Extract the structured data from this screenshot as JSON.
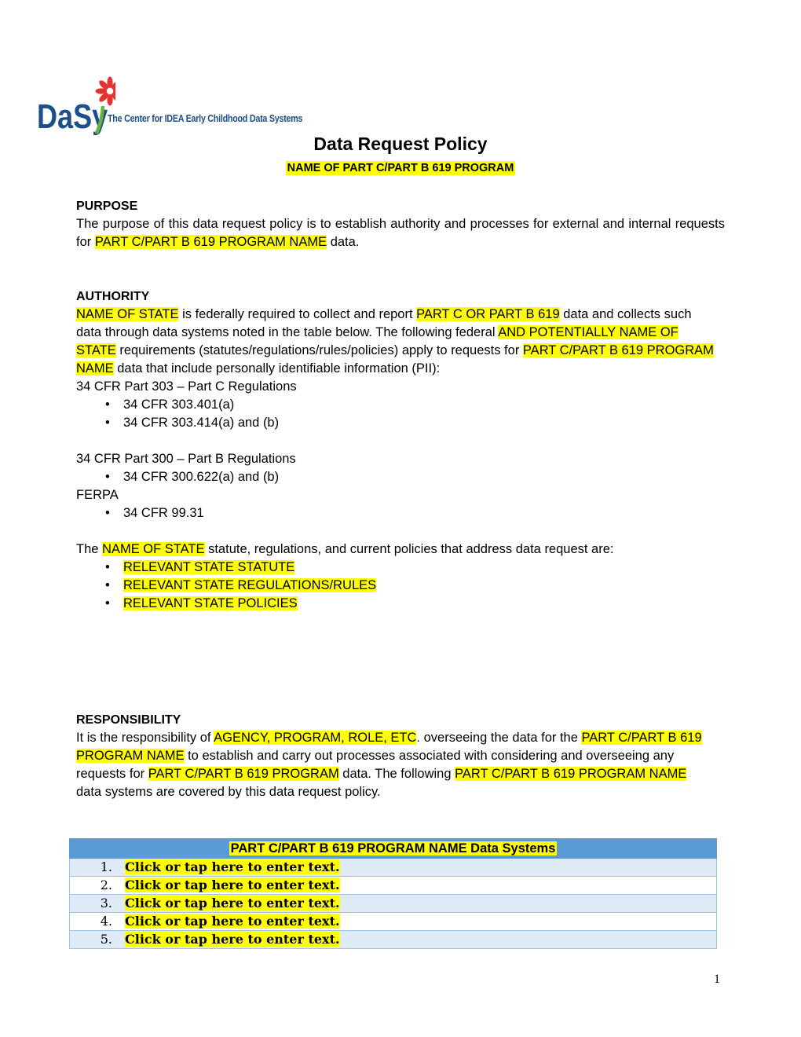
{
  "logo": {
    "brand": "DaSy",
    "tagline": "The Center for IDEA Early Childhood Data Systems",
    "icon": "flower-icon",
    "colors": {
      "brand_blue": "#1d4f8c",
      "flower_red": "#e8312f",
      "stem_green": "#6ab23e"
    }
  },
  "title": "Data Request Policy",
  "subtitle": "NAME OF PART C/PART B 619 PROGRAM",
  "highlight_color": "#ffff00",
  "purpose": {
    "heading": "PURPOSE",
    "text_1": "The purpose of this data request policy is to establish authority and processes for external and internal requests for ",
    "hl_1": "PART C/PART B 619 PROGRAM NAME",
    "text_2": " data."
  },
  "authority": {
    "heading": "AUTHORITY",
    "hl_1": "NAME OF STATE",
    "text_1": " is federally required to collect and report ",
    "hl_2": "PART C OR PART B 619",
    "text_2": " data and collects such data through data systems noted in the table below. The following federal ",
    "hl_3": "AND POTENTIALLY NAME OF STATE",
    "text_3": " requirements (statutes/regulations/rules/policies) apply to requests for ",
    "hl_4": "PART C/PART B 619 PROGRAM NAME",
    "text_4": " data that include personally identifiable information (PII):",
    "part_c_heading": "34 CFR Part 303 – Part C Regulations",
    "part_c_items": [
      "34 CFR 303.401(a)",
      "34 CFR 303.414(a) and (b)"
    ],
    "part_b_heading": "34 CFR Part 300 – Part B Regulations",
    "part_b_items": [
      "34 CFR 300.622(a) and (b)"
    ],
    "ferpa_heading": "FERPA",
    "ferpa_items": [
      "34 CFR 99.31"
    ],
    "state_text_1": "The ",
    "state_hl": "NAME OF STATE",
    "state_text_2": " statute, regulations, and current policies that address data request are:",
    "state_items": [
      "RELEVANT STATE STATUTE",
      "RELEVANT STATE REGULATIONS/RULES",
      "RELEVANT STATE POLICIES"
    ]
  },
  "responsibility": {
    "heading": "RESPONSIBILITY",
    "text_1": "It is the responsibility of ",
    "hl_1": "AGENCY, PROGRAM, ROLE, ETC",
    "text_2": ". overseeing the data for the ",
    "hl_2": "PART C/PART B 619 PROGRAM NAME",
    "text_3": " to establish and carry out processes associated with considering and overseeing any requests for ",
    "hl_3": "PART C/PART B 619 PROGRAM",
    "text_4": " data. The following ",
    "hl_4": "PART C/PART B 619 PROGRAM NAME",
    "text_5": " data systems are covered by this data request policy."
  },
  "data_systems_table": {
    "header": "PART C/PART B 619 PROGRAM NAME Data Systems",
    "header_color": "#5b9bd5",
    "band_color": "#deeaf6",
    "rows": [
      {
        "num": "1.",
        "placeholder": "Click or tap here to enter text."
      },
      {
        "num": "2.",
        "placeholder": "Click or tap here to enter text."
      },
      {
        "num": "3.",
        "placeholder": "Click or tap here to enter text."
      },
      {
        "num": "4.",
        "placeholder": "Click or tap here to enter text."
      },
      {
        "num": "5.",
        "placeholder": "Click or tap here to enter text."
      }
    ]
  },
  "page_number": "1"
}
